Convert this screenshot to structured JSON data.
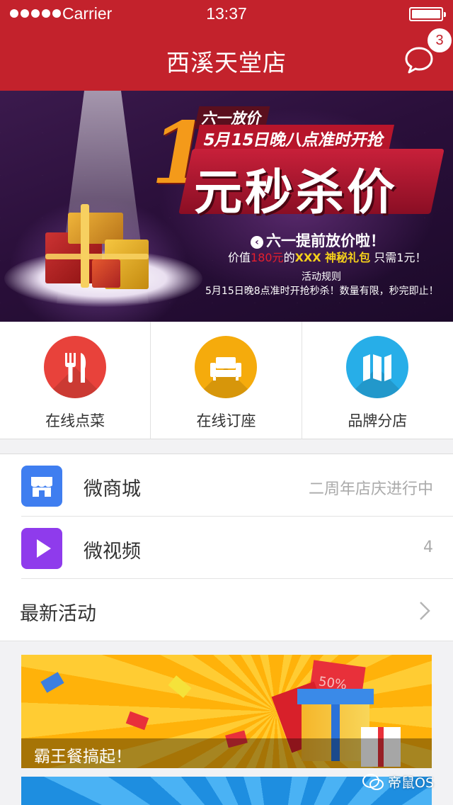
{
  "status_bar": {
    "carrier": "Carrier",
    "time": "13:37"
  },
  "header": {
    "title": "西溪天堂店",
    "message_badge": "3"
  },
  "banner": {
    "tag_small": "六一放价",
    "tag_time": "5月15日晚八点准时开抢",
    "big_number": "1",
    "headline": "元秒杀价",
    "line1": "六一提前放价啦！",
    "line2_prefix": "价值",
    "line2_price": "180元",
    "line2_mid": "的",
    "line2_gift": "XXX 神秘礼包",
    "line2_suffix": " 只需1元！",
    "rules_title": "活动规则",
    "rules_text": "5月15日晚8点准时开抢秒杀！数量有限，秒完即止！"
  },
  "quick_nav": [
    {
      "label": "在线点菜",
      "icon": "fork-knife-icon",
      "color": "#e8423b"
    },
    {
      "label": "在线订座",
      "icon": "sofa-icon",
      "color": "#f5ab0c"
    },
    {
      "label": "品牌分店",
      "icon": "map-icon",
      "color": "#27aee8"
    }
  ],
  "list": [
    {
      "title": "微商城",
      "right": "二周年店庆进行中",
      "icon": "store-icon",
      "color": "#3f7ef0"
    },
    {
      "title": "微视频",
      "right": "4",
      "icon": "play-icon",
      "color": "#8f3bec"
    },
    {
      "title": "最新活动",
      "icon": "chevron-right-icon"
    }
  ],
  "promo": {
    "caption": "霸王餐搞起！",
    "ticket_text": "50%"
  },
  "watermark": "帝鼠OS",
  "colors": {
    "header_red": "#c3222c"
  }
}
